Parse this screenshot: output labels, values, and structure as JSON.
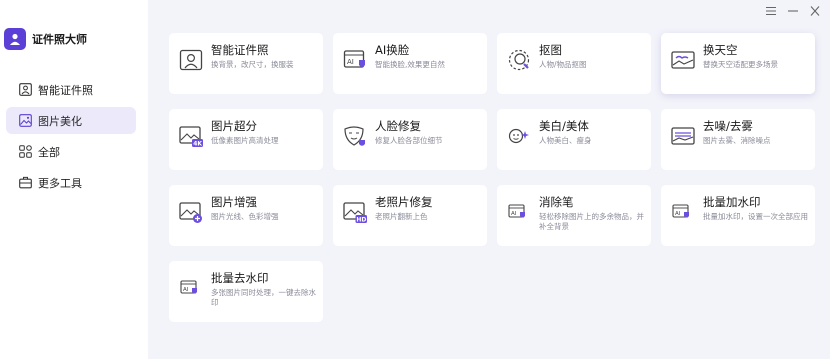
{
  "app": {
    "name": "证件照大师"
  },
  "colors": {
    "accent": "#5b3fd6",
    "active_bg": "#ece9fb",
    "bg": "#f3f4fa"
  },
  "sidebar": {
    "items": [
      {
        "label": "智能证件照",
        "icon": "id-photo-icon",
        "active": false
      },
      {
        "label": "图片美化",
        "icon": "image-beautify-icon",
        "active": true
      },
      {
        "label": "全部",
        "icon": "grid-icon",
        "active": false
      },
      {
        "label": "更多工具",
        "icon": "toolbox-icon",
        "active": false
      }
    ]
  },
  "window": {
    "controls": [
      "menu-icon",
      "minimize-icon",
      "close-icon"
    ]
  },
  "cards": [
    {
      "title": "智能证件照",
      "desc": "换背景，改尺寸，换服装",
      "icon": "id-photo-icon"
    },
    {
      "title": "AI换脸",
      "desc": "智能换脸,效果更自然",
      "icon": "ai-face-icon"
    },
    {
      "title": "抠图",
      "desc": "人物/物品抠图",
      "icon": "cutout-icon"
    },
    {
      "title": "换天空",
      "desc": "替换天空适配更多场景",
      "icon": "sky-icon"
    },
    {
      "title": "图片超分",
      "desc": "低像素图片高清处理",
      "icon": "4k-icon"
    },
    {
      "title": "人脸修复",
      "desc": "修复人脸各部位细节",
      "icon": "face-repair-icon"
    },
    {
      "title": "美白/美体",
      "desc": "人物美白、瘦身",
      "icon": "beauty-icon"
    },
    {
      "title": "去噪/去雾",
      "desc": "图片去雾、消除噪点",
      "icon": "denoise-icon"
    },
    {
      "title": "图片增强",
      "desc": "图片光线、色彩增强",
      "icon": "enhance-icon"
    },
    {
      "title": "老照片修复",
      "desc": "老照片翻新上色",
      "icon": "hd-icon"
    },
    {
      "title": "消除笔",
      "desc": "轻松移除图片上的多余物品，并补全背景",
      "icon": "eraser-icon"
    },
    {
      "title": "批量加水印",
      "desc": "批量加水印，设置一次全部应用",
      "icon": "add-watermark-icon"
    },
    {
      "title": "批量去水印",
      "desc": "多张图片同时处理，一键去除水印",
      "icon": "remove-watermark-icon"
    }
  ]
}
